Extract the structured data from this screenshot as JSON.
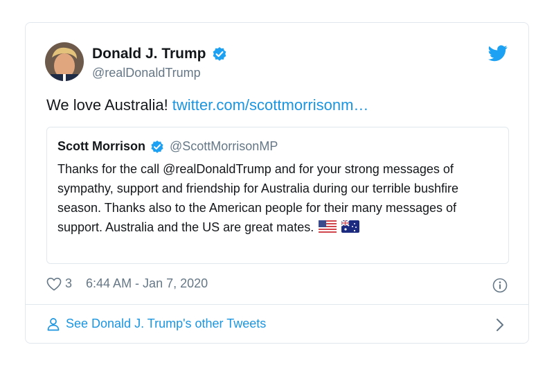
{
  "tweet": {
    "author": {
      "name": "Donald J. Trump",
      "handle": "@realDonaldTrump"
    },
    "text": "We love Australia! ",
    "link_text": "twitter.com/scottmorrisonm…",
    "quote": {
      "name": "Scott Morrison",
      "handle": "@ScottMorrisonMP",
      "text": "Thanks for the call @realDonaldTrump and for your strong messages of sympathy, support and friendship for Australia during our terrible bushfire season. Thanks also to the American people for their many messages of support. Australia and the US are great mates."
    },
    "likes": "3",
    "timestamp": "6:44 AM - Jan 7, 2020",
    "footer_link": "See Donald J. Trump's other Tweets"
  },
  "icons": [
    "avatar",
    "verified-badge-icon",
    "twitter-bird-icon",
    "us-flag-icon",
    "australia-flag-icon",
    "heart-icon",
    "info-icon",
    "person-icon",
    "chevron-right-icon"
  ],
  "colors": {
    "link": "#1b95e0",
    "text": "#14171a",
    "secondary": "#657786",
    "border": "#e1e8ed",
    "verified": "#1da1f2"
  }
}
